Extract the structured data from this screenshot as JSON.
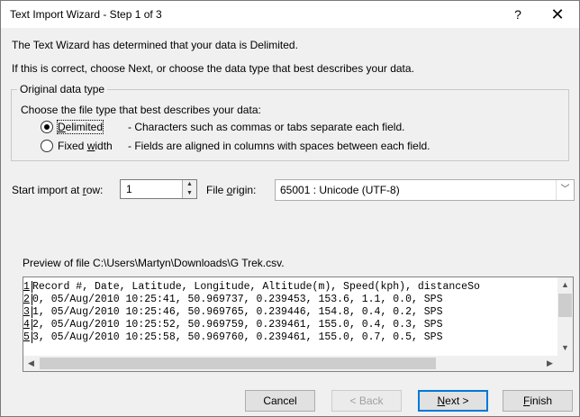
{
  "window": {
    "title": "Text Import Wizard - Step 1 of 3",
    "help_label": "?",
    "close_label": "✕"
  },
  "intro": {
    "line1": "The Text Wizard has determined that your data is Delimited.",
    "line2": "If this is correct, choose Next, or choose the data type that best describes your data."
  },
  "data_type": {
    "legend": "Original data type",
    "prompt": "Choose the file type that best describes your data:",
    "options": [
      {
        "label_pre": "",
        "label_key": "D",
        "label_post": "elimited",
        "desc": "- Characters such as commas or tabs separate each field.",
        "checked": true
      },
      {
        "label_pre": "Fixed ",
        "label_key": "w",
        "label_post": "idth",
        "desc": "- Fields are aligned in columns with spaces between each field.",
        "checked": false
      }
    ]
  },
  "start_row": {
    "label_pre": "Start import at ",
    "label_key": "r",
    "label_post": "ow:",
    "value": "1"
  },
  "file_origin": {
    "label_pre": "File ",
    "label_key": "o",
    "label_post": "rigin:",
    "value": "65001 : Unicode (UTF-8)"
  },
  "preview": {
    "label": "Preview of file C:\\Users\\Martyn\\Downloads\\G Trek.csv.",
    "rows": [
      {
        "num": "1",
        "text": "Record #, Date, Latitude, Longitude, Altitude(m), Speed(kph), distanceSo"
      },
      {
        "num": "2",
        "text": "0, 05/Aug/2010 10:25:41, 50.969737, 0.239453, 153.6, 1.1, 0.0, SPS"
      },
      {
        "num": "3",
        "text": "1, 05/Aug/2010 10:25:46, 50.969765, 0.239446, 154.8, 0.4, 0.2, SPS"
      },
      {
        "num": "4",
        "text": "2, 05/Aug/2010 10:25:52, 50.969759, 0.239461, 155.0, 0.4, 0.3, SPS"
      },
      {
        "num": "5",
        "text": "3, 05/Aug/2010 10:25:58, 50.969760, 0.239461, 155.0, 0.7, 0.5, SPS"
      }
    ]
  },
  "buttons": {
    "cancel": "Cancel",
    "back": "< Back",
    "next_key": "N",
    "next_rest": "ext >",
    "finish_key": "F",
    "finish_rest": "inish"
  },
  "colors": {
    "default_button_border": "#0078d7",
    "window_bg": "#f0f0f0"
  },
  "icons": {
    "spin_up": "▲",
    "spin_down": "▼",
    "dropdown": "﹀",
    "scroll_up": "▲",
    "scroll_down": "▼",
    "scroll_left": "◀",
    "scroll_right": "▶"
  }
}
